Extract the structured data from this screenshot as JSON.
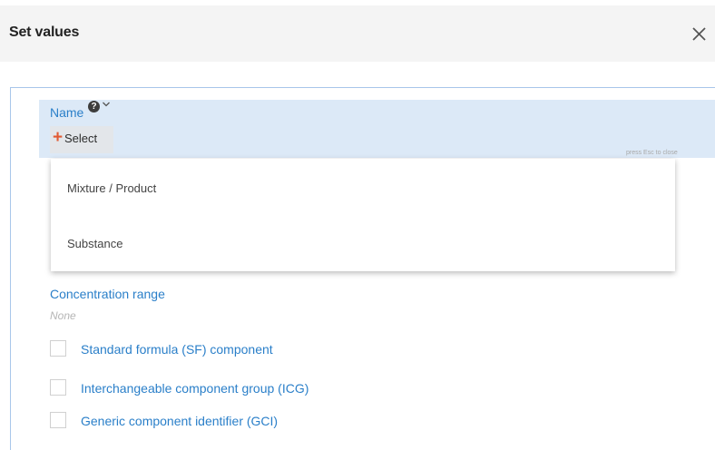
{
  "dialog": {
    "title": "Set values",
    "close_label": "✕"
  },
  "name_field": {
    "label": "Name",
    "help_icon": "?",
    "select_plus": "+",
    "select_label": "Select",
    "esc_hint": "press Esc to close"
  },
  "dropdown": {
    "options": [
      {
        "label": "Mixture / Product"
      },
      {
        "label": "Substance"
      }
    ]
  },
  "concentration": {
    "label": "Concentration range",
    "value": "None"
  },
  "checkboxes": [
    {
      "label": "Standard formula (SF) component",
      "checked": false
    },
    {
      "label": "Interchangeable component group (ICG)",
      "checked": false
    },
    {
      "label": "Generic component identifier (GCI)",
      "checked": false
    }
  ],
  "colors": {
    "accent": "#2a7fc9",
    "plus": "#e25a33",
    "row_highlight": "#dce9f7"
  }
}
